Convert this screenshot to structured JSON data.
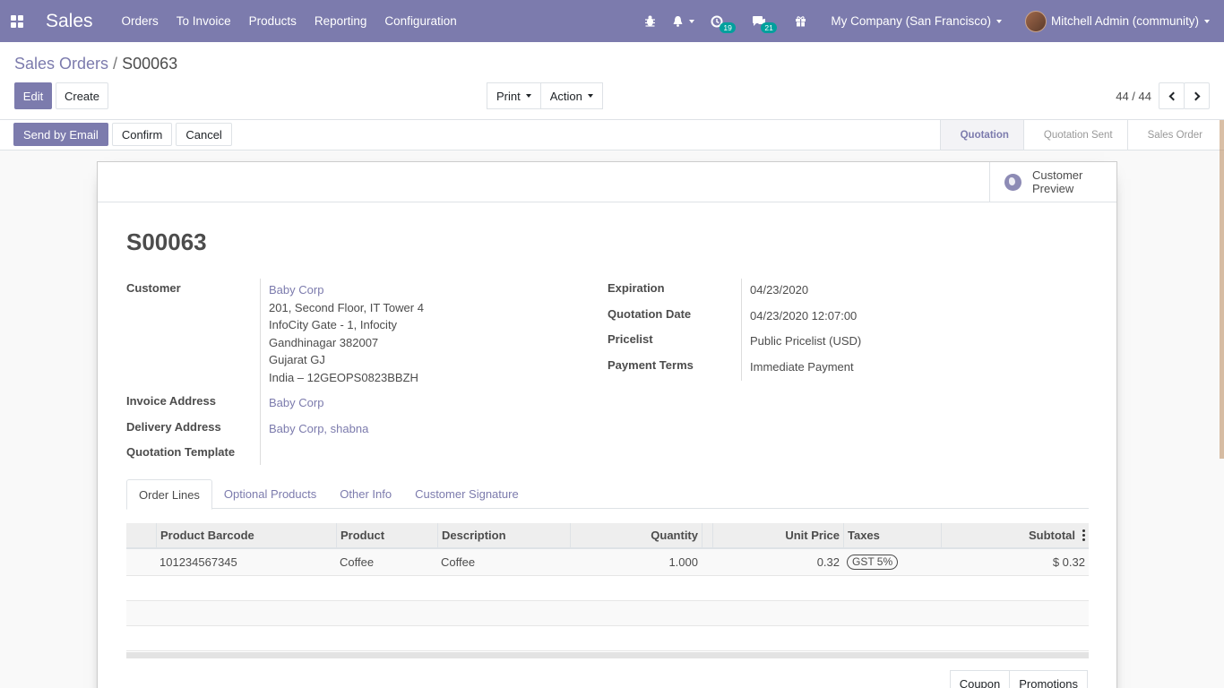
{
  "navbar": {
    "app_name": "Sales",
    "menu": [
      "Orders",
      "To Invoice",
      "Products",
      "Reporting",
      "Configuration"
    ],
    "activity_count": "19",
    "messages_count": "21",
    "company": "My Company (San Francisco)",
    "user": "Mitchell Admin (community)",
    "icons": [
      "apps-icon",
      "bug-icon",
      "bell-icon",
      "clock-icon",
      "chat-icon",
      "gift-icon"
    ]
  },
  "breadcrumb": {
    "parent": "Sales Orders",
    "separator": "/",
    "current": "S00063"
  },
  "toolbar": {
    "edit": "Edit",
    "create": "Create",
    "print": "Print",
    "action": "Action"
  },
  "pager": {
    "value": "44 / 44"
  },
  "statusbar": {
    "actions": [
      "Send by Email",
      "Confirm",
      "Cancel"
    ],
    "stages": [
      "Quotation",
      "Quotation Sent",
      "Sales Order"
    ],
    "active_stage": "Quotation"
  },
  "sheet": {
    "preview_button": "Customer Preview",
    "title": "S00063",
    "left_fields": [
      {
        "label": "Customer",
        "value": "Baby Corp",
        "address": [
          "201, Second Floor, IT Tower 4",
          "InfoCity Gate - 1, Infocity",
          "Gandhinagar 382007",
          "Gujarat GJ",
          "India – 12GEOPS0823BBZH"
        ]
      },
      {
        "label": "Invoice Address",
        "value": "Baby Corp"
      },
      {
        "label": "Delivery Address",
        "value": "Baby Corp, shabna"
      },
      {
        "label": "Quotation Template",
        "value": ""
      }
    ],
    "right_fields": [
      {
        "label": "Expiration",
        "value": "04/23/2020"
      },
      {
        "label": "Quotation Date",
        "value": "04/23/2020 12:07:00"
      },
      {
        "label": "Pricelist",
        "value": "Public Pricelist (USD)"
      },
      {
        "label": "Payment Terms",
        "value": "Immediate Payment"
      }
    ],
    "tabs": [
      "Order Lines",
      "Optional Products",
      "Other Info",
      "Customer Signature"
    ],
    "active_tab": "Order Lines",
    "table": {
      "headers": [
        "Product Barcode",
        "Product",
        "Description",
        "Quantity",
        "Unit Price",
        "Taxes",
        "Subtotal"
      ],
      "rows": [
        {
          "barcode": "101234567345",
          "product": "Coffee",
          "description": "Coffee",
          "quantity": "1.000",
          "unit_price": "0.32",
          "taxes": "GST 5%",
          "subtotal": "$ 0.32"
        }
      ]
    },
    "bottom_buttons": [
      "Coupon",
      "Promotions"
    ]
  },
  "colors": {
    "brand": "#7c7bad",
    "badge": "#00a09d"
  }
}
